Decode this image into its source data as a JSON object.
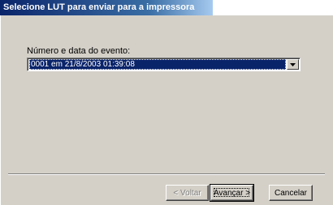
{
  "window": {
    "title": "Selecione LUT para enviar para a impressora"
  },
  "form": {
    "event_label": "Número e data do evento:",
    "event_selected": "0001 em 21/8/2003 01:39:08"
  },
  "buttons": {
    "back_label": "< Voltar",
    "next_label": "Avançar >",
    "cancel_label": "Cancelar"
  },
  "colors": {
    "titlebar_start": "#0a246a",
    "titlebar_end": "#a6caf0",
    "selection": "#0a246a",
    "face": "#d4d0c8"
  },
  "icons": {
    "dropdown": "chevron-down-icon"
  }
}
